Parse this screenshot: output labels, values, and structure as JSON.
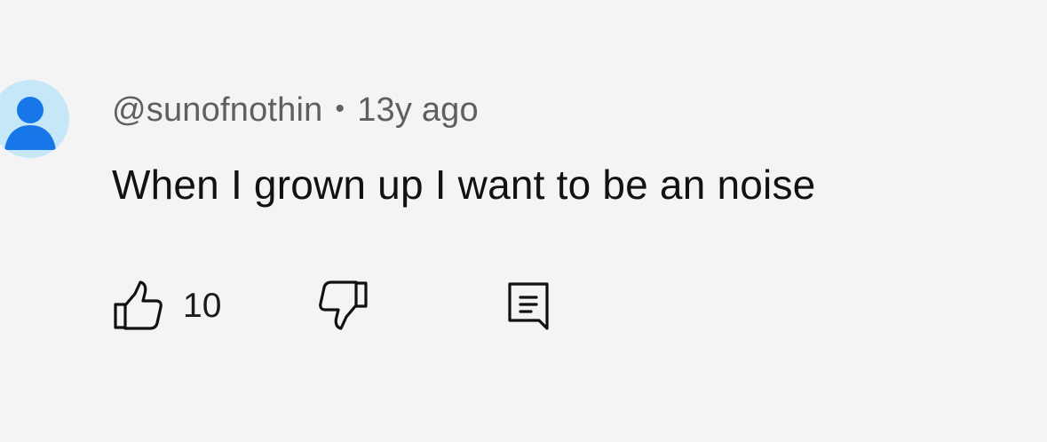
{
  "comment": {
    "author": "@sunofnothin",
    "separator": "•",
    "age": "13y ago",
    "text": "When I grown up I want to be an noise",
    "likes": "10"
  },
  "icons": {
    "avatar": "default-avatar-icon",
    "like": "thumbs-up-icon",
    "dislike": "thumbs-down-icon",
    "reply": "reply-comment-icon"
  },
  "colors": {
    "background": "#f4f4f4",
    "avatar_background": "#c6e7f7",
    "avatar_figure": "#1877e8",
    "meta_text": "#5f5f5f",
    "body_text": "#121212"
  }
}
